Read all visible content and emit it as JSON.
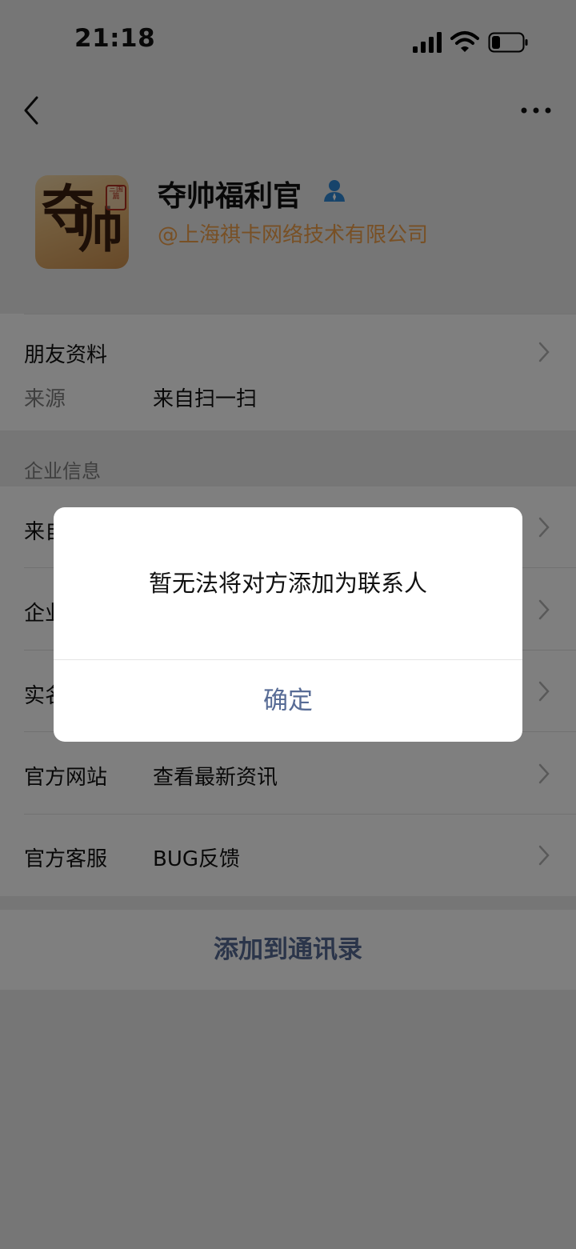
{
  "status_bar": {
    "time": "21:18"
  },
  "profile": {
    "name": "夺帅福利官",
    "company": "@上海祺卡网络技术有限公司",
    "avatar_text_1": "夺",
    "avatar_text_2": "帅",
    "avatar_seal": "三国篇"
  },
  "friend_info": {
    "title": "朋友资料",
    "source_label": "来源",
    "source_value": "来自扫一扫"
  },
  "enterprise": {
    "section_label": "企业信息",
    "rows": [
      {
        "label": "来自",
        "value": ""
      },
      {
        "label": "企业",
        "value": ""
      },
      {
        "label": "实名",
        "value": ""
      },
      {
        "label": "官方网站",
        "value": "查看最新资讯"
      },
      {
        "label": "官方客服",
        "value": "BUG反馈"
      }
    ]
  },
  "add_button": "添加到通讯录",
  "dialog": {
    "message": "暂无法将对方添加为联系人",
    "ok_label": "确定"
  },
  "colors": {
    "link": "#576b95",
    "company": "#f0a04b",
    "verified": "#2f89d6"
  }
}
